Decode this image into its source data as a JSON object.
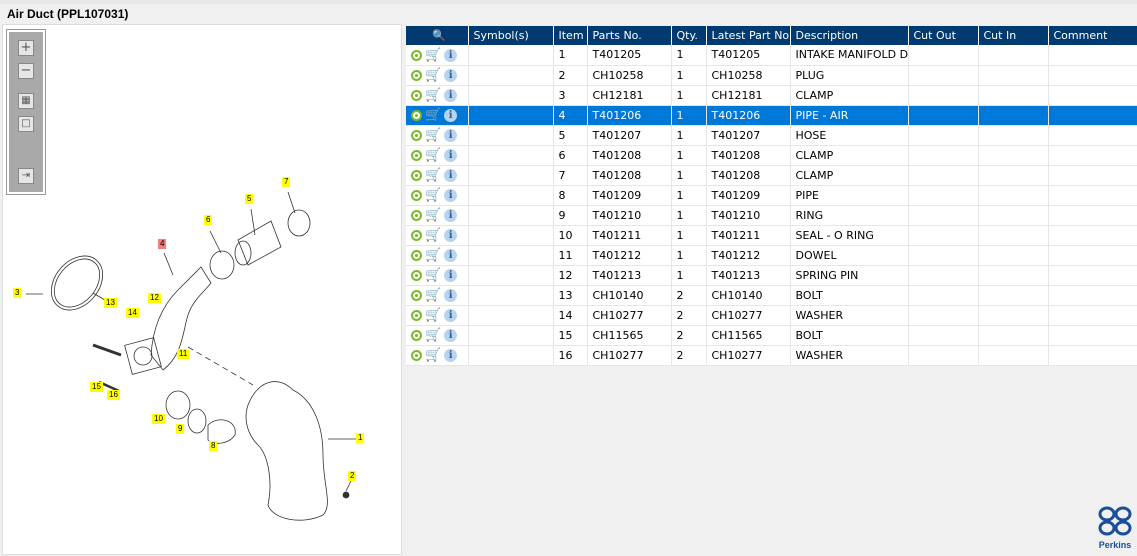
{
  "title": "Air Duct (PPL107031)",
  "toolbar": {
    "icons": [
      "zoom-in-icon",
      "zoom-out-icon",
      "fit-icon",
      "actual-size-icon",
      "export-icon"
    ]
  },
  "callouts": [
    {
      "n": "1"
    },
    {
      "n": "2"
    },
    {
      "n": "3"
    },
    {
      "n": "4"
    },
    {
      "n": "5"
    },
    {
      "n": "6"
    },
    {
      "n": "7"
    },
    {
      "n": "8"
    },
    {
      "n": "9"
    },
    {
      "n": "10"
    },
    {
      "n": "11"
    },
    {
      "n": "12"
    },
    {
      "n": "13"
    },
    {
      "n": "14"
    },
    {
      "n": "15"
    },
    {
      "n": "16"
    }
  ],
  "table": {
    "headers": [
      "",
      "Symbol(s)",
      "Item",
      "Parts No.",
      "Qty.",
      "Latest Part No.",
      "Description",
      "Cut Out",
      "Cut In",
      "Comment"
    ],
    "selected_item": "4",
    "rows": [
      [
        "1",
        "T401205",
        "1",
        "T401205",
        "INTAKE MANIFOLD DUCT"
      ],
      [
        "2",
        "CH10258",
        "1",
        "CH10258",
        "PLUG"
      ],
      [
        "3",
        "CH12181",
        "1",
        "CH12181",
        "CLAMP"
      ],
      [
        "4",
        "T401206",
        "1",
        "T401206",
        "PIPE - AIR"
      ],
      [
        "5",
        "T401207",
        "1",
        "T401207",
        "HOSE"
      ],
      [
        "6",
        "T401208",
        "1",
        "T401208",
        "CLAMP"
      ],
      [
        "7",
        "T401208",
        "1",
        "T401208",
        "CLAMP"
      ],
      [
        "8",
        "T401209",
        "1",
        "T401209",
        "PIPE"
      ],
      [
        "9",
        "T401210",
        "1",
        "T401210",
        "RING"
      ],
      [
        "10",
        "T401211",
        "1",
        "T401211",
        "SEAL - O RING"
      ],
      [
        "11",
        "T401212",
        "1",
        "T401212",
        "DOWEL"
      ],
      [
        "12",
        "T401213",
        "1",
        "T401213",
        "SPRING PIN"
      ],
      [
        "13",
        "CH10140",
        "2",
        "CH10140",
        "BOLT"
      ],
      [
        "14",
        "CH10277",
        "2",
        "CH10277",
        "WASHER"
      ],
      [
        "15",
        "CH11565",
        "2",
        "CH11565",
        "BOLT"
      ],
      [
        "16",
        "CH10277",
        "2",
        "CH10277",
        "WASHER"
      ]
    ]
  },
  "logo": "Perkins",
  "colors": {
    "header": "#003a70",
    "selected": "#0078d7",
    "callout": "#ffff00",
    "callout_selected": "#f08080"
  }
}
